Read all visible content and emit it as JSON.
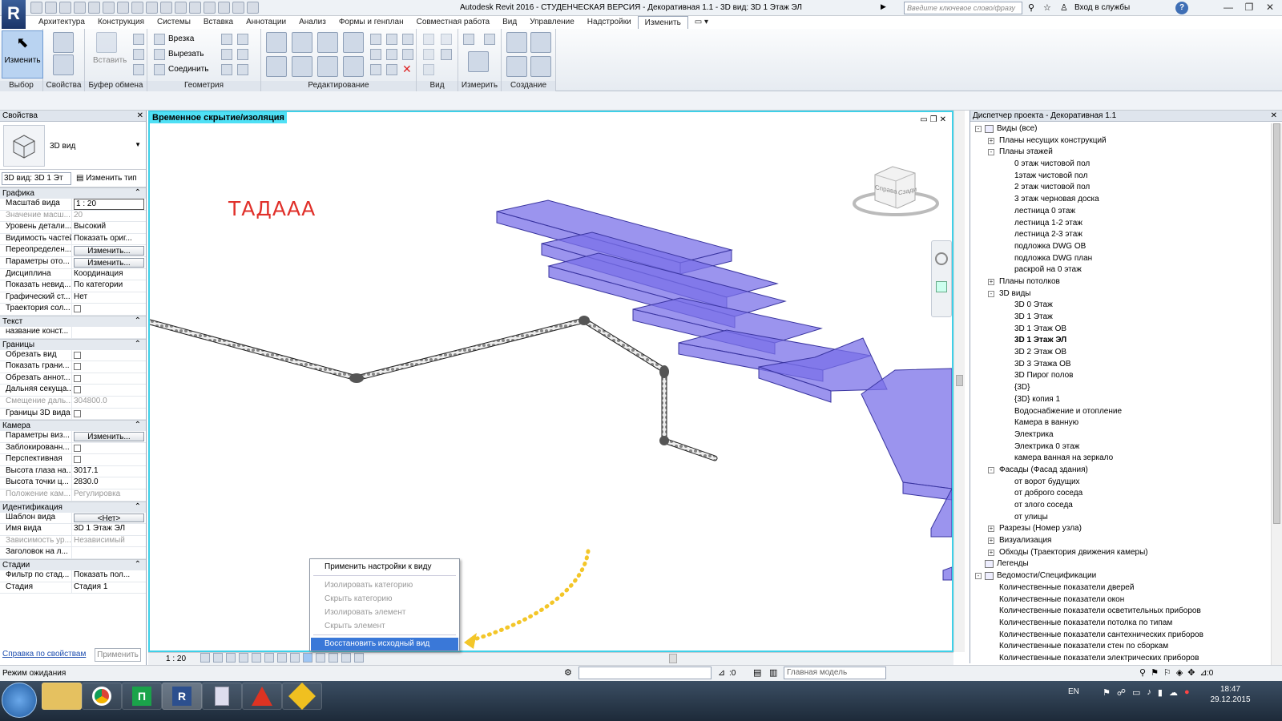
{
  "app": {
    "window_title": "Autodesk Revit 2016 -  СТУДЕНЧЕСКАЯ ВЕРСИЯ -    Декоративная 1.1 - 3D вид: 3D 1 Этаж ЭЛ",
    "search_placeholder": "Введите ключевое слово/фразу",
    "sign_in": "Вход в службы",
    "help": "?"
  },
  "tabs": [
    "Архитектура",
    "Конструкция",
    "Системы",
    "Вставка",
    "Аннотации",
    "Анализ",
    "Формы и генплан",
    "Совместная работа",
    "Вид",
    "Управление",
    "Надстройки",
    "Изменить"
  ],
  "ribbon": {
    "select_label": "Изменить",
    "select_group": "Выбор",
    "groups": [
      "Свойства",
      "Буфер обмена",
      "Геометрия",
      "Редактирование",
      "Вид",
      "Измерить",
      "Создание"
    ],
    "paste_label": "Вставить",
    "cope_label": "Врезка",
    "cut_label": "Вырезать",
    "join_label": "Соединить"
  },
  "properties": {
    "title": "Свойства",
    "type_name": "3D вид",
    "view_combo": "3D вид: 3D 1 Эт",
    "edit_type": "Изменить тип",
    "sections": [
      {
        "name": "Графика",
        "rows": [
          {
            "k": "Масштаб вида",
            "v": "1 : 20",
            "style": "box"
          },
          {
            "k": "Значение масш...",
            "v": "20",
            "style": "grey"
          },
          {
            "k": "Уровень детали...",
            "v": "Высокий"
          },
          {
            "k": "Видимость частей",
            "v": "Показать ориг..."
          },
          {
            "k": "Переопределен...",
            "v": "Изменить...",
            "style": "btn"
          },
          {
            "k": "Параметры ото...",
            "v": "Изменить...",
            "style": "btn"
          },
          {
            "k": "Дисциплина",
            "v": "Координация"
          },
          {
            "k": "Показать невид...",
            "v": "По категории"
          },
          {
            "k": "Графический ст...",
            "v": "Нет"
          },
          {
            "k": "Траектория сол...",
            "v": "",
            "style": "cb"
          }
        ]
      },
      {
        "name": "Текст",
        "rows": [
          {
            "k": "название конст...",
            "v": ""
          }
        ]
      },
      {
        "name": "Границы",
        "rows": [
          {
            "k": "Обрезать вид",
            "v": "",
            "style": "cb"
          },
          {
            "k": "Показать грани...",
            "v": "",
            "style": "cb"
          },
          {
            "k": "Обрезать аннот...",
            "v": "",
            "style": "cb"
          },
          {
            "k": "Дальняя секуща...",
            "v": "",
            "style": "cb"
          },
          {
            "k": "Смещение даль...",
            "v": "304800.0",
            "style": "grey"
          },
          {
            "k": "Границы 3D вида",
            "v": "",
            "style": "cb"
          }
        ]
      },
      {
        "name": "Камера",
        "rows": [
          {
            "k": "Параметры виз...",
            "v": "Изменить...",
            "style": "btn"
          },
          {
            "k": "Заблокированн...",
            "v": "",
            "style": "cb"
          },
          {
            "k": "Перспективная",
            "v": "",
            "style": "cb"
          },
          {
            "k": "Высота глаза на...",
            "v": "3017.1"
          },
          {
            "k": "Высота точки ц...",
            "v": "2830.0"
          },
          {
            "k": "Положение кам...",
            "v": "Регулировка",
            "style": "grey"
          }
        ]
      },
      {
        "name": "Идентификация",
        "rows": [
          {
            "k": "Шаблон вида",
            "v": "<Нет>",
            "style": "btn"
          },
          {
            "k": "Имя вида",
            "v": "3D 1 Этаж ЭЛ"
          },
          {
            "k": "Зависимость ур...",
            "v": "Независимый",
            "style": "grey"
          },
          {
            "k": "Заголовок на л...",
            "v": ""
          }
        ]
      },
      {
        "name": "Стадии",
        "rows": [
          {
            "k": "Фильтр по стад...",
            "v": "Показать пол..."
          },
          {
            "k": "Стадия",
            "v": "Стадия 1"
          }
        ]
      }
    ],
    "help_link": "Справка по свойствам",
    "apply": "Применить"
  },
  "canvas": {
    "iso_label": "Временное скрытие/изоляция",
    "annotation": "ТАДААА",
    "cube_left": "Справа",
    "cube_right": "Сзади",
    "scale": "1 : 20"
  },
  "context_menu": {
    "apply": "Применить настройки к виду",
    "isolate_cat": "Изолировать категорию",
    "hide_cat": "Скрыть категорию",
    "isolate_el": "Изолировать элемент",
    "hide_el": "Скрыть элемент",
    "restore": "Восстановить исходный вид"
  },
  "browser": {
    "title": "Диспетчер проекта - Декоративная 1.1",
    "items": [
      {
        "t": "Виды (все)",
        "l": 0,
        "x": "-",
        "icon": true
      },
      {
        "t": "Планы несущих конструкций",
        "l": 1,
        "x": "+"
      },
      {
        "t": "Планы этажей",
        "l": 1,
        "x": "-"
      },
      {
        "t": "0 этаж чистовой пол",
        "l": 2
      },
      {
        "t": "1этаж чистовой пол",
        "l": 2
      },
      {
        "t": "2 этаж чистовой пол",
        "l": 2
      },
      {
        "t": "3 этаж черновая доска",
        "l": 2
      },
      {
        "t": "лестница 0 этаж",
        "l": 2
      },
      {
        "t": "лестница 1-2 этаж",
        "l": 2
      },
      {
        "t": "лестница 2-3 этаж",
        "l": 2
      },
      {
        "t": "подложка DWG ОВ",
        "l": 2
      },
      {
        "t": "подложка DWG план",
        "l": 2
      },
      {
        "t": "раскрой на 0 этаж",
        "l": 2
      },
      {
        "t": "Планы потолков",
        "l": 1,
        "x": "+"
      },
      {
        "t": "3D виды",
        "l": 1,
        "x": "-"
      },
      {
        "t": "3D 0 Этаж",
        "l": 2
      },
      {
        "t": "3D 1 Этаж",
        "l": 2
      },
      {
        "t": "3D 1 Этаж ОВ",
        "l": 2
      },
      {
        "t": "3D 1 Этаж ЭЛ",
        "l": 2,
        "b": true
      },
      {
        "t": "3D 2 Этаж ОВ",
        "l": 2
      },
      {
        "t": "3D 3 Этажа ОВ",
        "l": 2
      },
      {
        "t": "3D Пирог полов",
        "l": 2
      },
      {
        "t": "{3D}",
        "l": 2
      },
      {
        "t": "{3D} копия 1",
        "l": 2
      },
      {
        "t": "Водоснабжение и отопление",
        "l": 2
      },
      {
        "t": "Камера в ванную",
        "l": 2
      },
      {
        "t": "Электрика",
        "l": 2
      },
      {
        "t": "Электрика 0 этаж",
        "l": 2
      },
      {
        "t": "камера ванная на зеркало",
        "l": 2
      },
      {
        "t": "Фасады (Фасад здания)",
        "l": 1,
        "x": "-"
      },
      {
        "t": "от ворот будущих",
        "l": 2
      },
      {
        "t": "от доброго соседа",
        "l": 2
      },
      {
        "t": "от злого соседа",
        "l": 2
      },
      {
        "t": "от улицы",
        "l": 2
      },
      {
        "t": "Разрезы (Номер узла)",
        "l": 1,
        "x": "+"
      },
      {
        "t": "Визуализация",
        "l": 1,
        "x": "+"
      },
      {
        "t": "Обходы (Траектория движения камеры)",
        "l": 1,
        "x": "+"
      },
      {
        "t": "Легенды",
        "l": 0,
        "icon": true
      },
      {
        "t": "Ведомости/Спецификации",
        "l": 0,
        "x": "-",
        "icon": true
      },
      {
        "t": "Количественные показатели дверей",
        "l": 1
      },
      {
        "t": "Количественные показатели окон",
        "l": 1
      },
      {
        "t": "Количественные показатели осветительных приборов",
        "l": 1
      },
      {
        "t": "Количественные показатели потолка по типам",
        "l": 1
      },
      {
        "t": "Количественные показатели сантехнических приборов",
        "l": 1
      },
      {
        "t": "Количественные показатели стен по сборкам",
        "l": 1
      },
      {
        "t": "Количественные показатели электрических приборов",
        "l": 1
      }
    ]
  },
  "status": {
    "text": "Режим ожидания",
    "sel": ":0",
    "model": "Главная модель",
    "right_sel": ":0"
  },
  "taskbar": {
    "lang": "EN",
    "time": "18:47",
    "date": "29.12.2015"
  },
  "colors": {
    "accent": "#3ed0e8",
    "highlight": "#3a78d8",
    "geometry": "#7a70e8"
  }
}
